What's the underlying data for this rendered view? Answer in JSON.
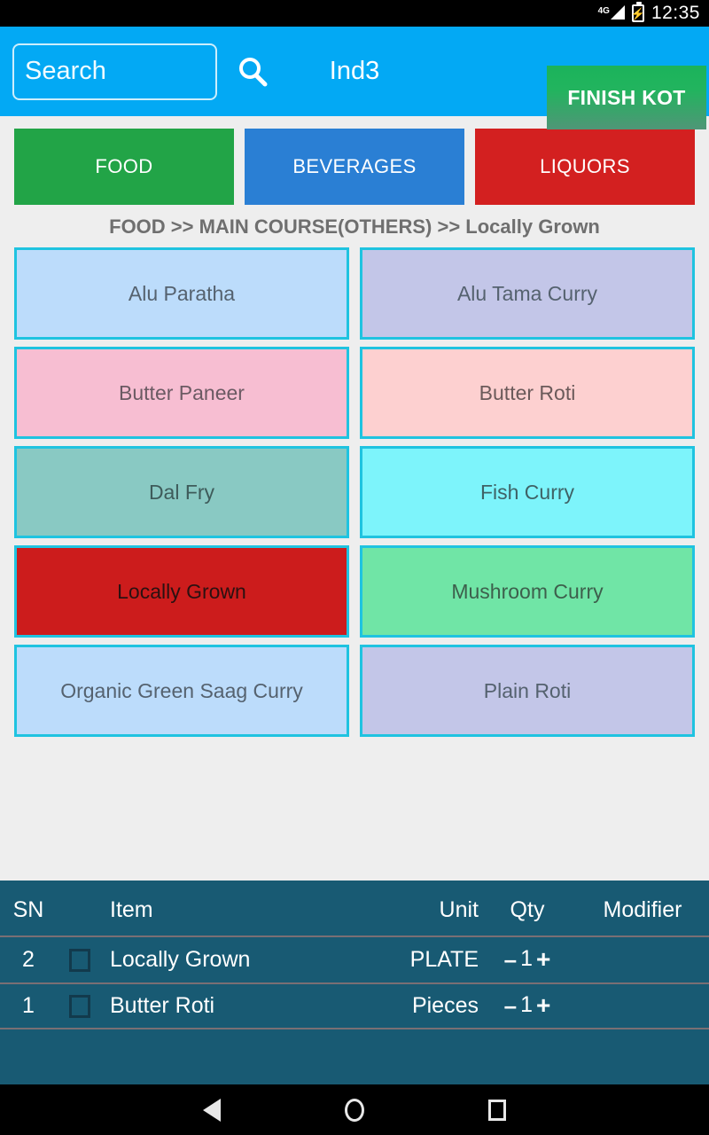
{
  "status_bar": {
    "network_label": "4G",
    "network_icon": "signal-bars-icon",
    "battery_icon": "battery-charging-icon",
    "time": "12:35"
  },
  "appbar": {
    "search_placeholder": "Search",
    "search_value": "",
    "search_icon": "search-icon",
    "title": "Ind3",
    "finish_button": "FINISH KOT",
    "background_color": "#03a9f4"
  },
  "tabs": [
    {
      "label": "FOOD",
      "color": "#22a447"
    },
    {
      "label": "BEVERAGES",
      "color": "#2a7fd4"
    },
    {
      "label": "LIQUORS",
      "color": "#d32020"
    },
    {
      "label": "",
      "color": "#2a3fa0"
    }
  ],
  "breadcrumb": "FOOD >> MAIN COURSE(OTHERS) >> Locally Grown",
  "items": [
    {
      "label": "Alu Paratha",
      "bg": "#bcdcfb",
      "fg": "#55626f"
    },
    {
      "label": "Alu Tama Curry",
      "bg": "#c3c6e8",
      "fg": "#55626f"
    },
    {
      "label": "Butter Paneer",
      "bg": "#f7bed2",
      "fg": "#6b5a63"
    },
    {
      "label": "Butter Roti",
      "bg": "#fdd0d0",
      "fg": "#6b5a5a"
    },
    {
      "label": "Dal Fry",
      "bg": "#89c9c3",
      "fg": "#3e5b5a"
    },
    {
      "label": "Fish Curry",
      "bg": "#7df4fb",
      "fg": "#3f6266"
    },
    {
      "label": "Locally Grown",
      "bg": "#cc1c1c",
      "fg": "#2b1111"
    },
    {
      "label": "Mushroom Curry",
      "bg": "#70e5a6",
      "fg": "#3d5f4c"
    },
    {
      "label": "Organic Green Saag Curry",
      "bg": "#bcdcfb",
      "fg": "#55626f"
    },
    {
      "label": "Plain Roti",
      "bg": "#c3c6e8",
      "fg": "#55626f"
    }
  ],
  "order": {
    "panel_color": "#185a73",
    "headers": {
      "sn": "SN",
      "item": "Item",
      "unit": "Unit",
      "qty": "Qty",
      "modifier": "Modifier"
    },
    "rows": [
      {
        "sn": "2",
        "checked": false,
        "item": "Locally Grown",
        "unit": "PLATE",
        "minus": "–",
        "qty": "1",
        "plus": "+",
        "modifier": ""
      },
      {
        "sn": "1",
        "checked": false,
        "item": "Butter Roti",
        "unit": "Pieces",
        "minus": "–",
        "qty": "1",
        "plus": "+",
        "modifier": ""
      }
    ]
  },
  "navbar": {
    "back": "back-icon",
    "home": "home-icon",
    "recents": "recents-icon"
  }
}
